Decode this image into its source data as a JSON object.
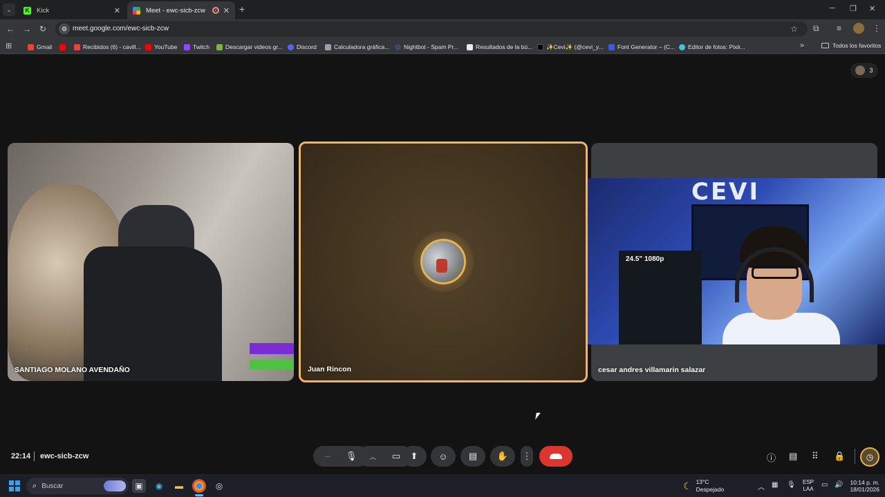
{
  "browser": {
    "tabs": [
      {
        "title": "Kick",
        "icon": "kick-icon"
      },
      {
        "title": "Meet - ewc-sicb-zcw",
        "icon": "meet-icon",
        "active": true
      }
    ],
    "url": "meet.google.com/ewc-sicb-zcw",
    "bookmarks": [
      {
        "label": "Gmail",
        "color": "#ea4335"
      },
      {
        "label": "Recibidos (6) - cavill...",
        "color": "#ff0000"
      },
      {
        "label": "YouTube",
        "color": "#ff0000"
      },
      {
        "label": "Twitch",
        "color": "#9146ff"
      },
      {
        "label": "Descargar videos gr...",
        "color": "#7cb342"
      },
      {
        "label": "Discord",
        "color": "#5865f2"
      },
      {
        "label": "Calculadora gráfica...",
        "color": "#9aa0a6"
      },
      {
        "label": "Nightbot - Spam Pr...",
        "color": "#3a4a6b"
      },
      {
        "label": "Resultados de la bú...",
        "color": "#e8eaed"
      },
      {
        "label": "✨Cevi✨ (@cevi_y...",
        "color": "#111111"
      },
      {
        "label": "Font Generator – (C...",
        "color": "#3b5bdb"
      },
      {
        "label": "Editor de fotos: Pixlr...",
        "color": "#3ec6e0"
      }
    ],
    "all_bookmarks": "Todos los favoritos"
  },
  "meet": {
    "participant_count": "3",
    "participants": [
      {
        "name": "SANTIAGO MOLANO AVENDAÑO"
      },
      {
        "name": "Juan Rincon",
        "speaking": true
      },
      {
        "name": "cesar andres villamarin salazar"
      }
    ],
    "tile3_logo": "CEVI",
    "tile3_shelf": "24.5\" 1080p",
    "time": "22:14",
    "meeting_code": "ewc-sicb-zcw"
  },
  "colors": {
    "accent": "#f4b560",
    "end_call": "#dc362e",
    "stage_bg": "#131314"
  },
  "taskbar": {
    "search_placeholder": "Buscar",
    "weather_temp": "13°C",
    "weather_desc": "Despejado",
    "lang_1": "ESP",
    "lang_2": "LAA",
    "clock_time": "10:14 p. m.",
    "clock_date": "18/01/2026"
  }
}
